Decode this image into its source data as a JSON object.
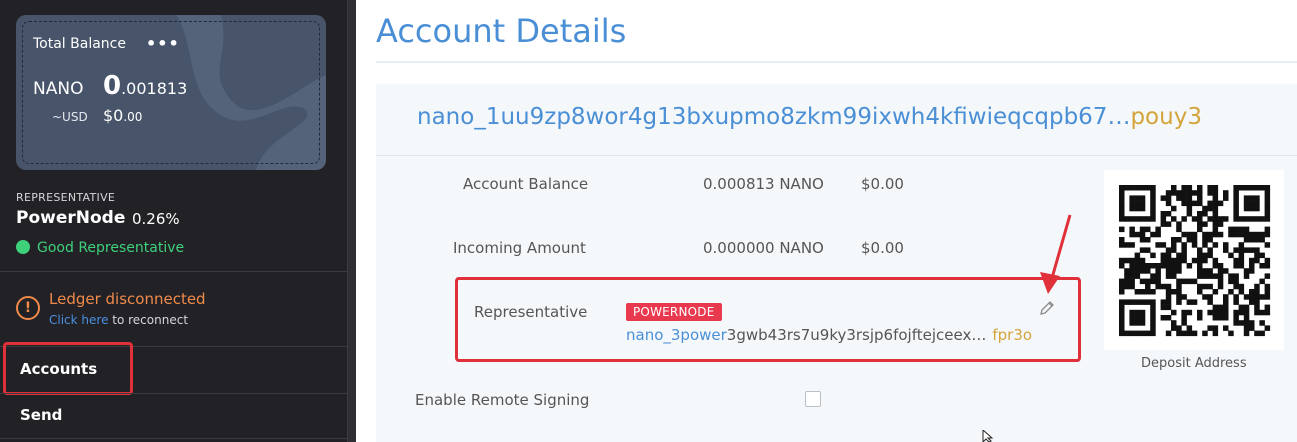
{
  "sidebar": {
    "balance_card": {
      "title": "Total Balance",
      "menu_icon": "more-dots-icon",
      "nano_label": "NANO",
      "nano_value_whole": "0",
      "nano_value_fraction": ".001813",
      "usd_label": "~USD",
      "usd_value_main": "$0",
      "usd_value_fraction": ".00"
    },
    "representative": {
      "heading": "REPRESENTATIVE",
      "name": "PowerNode",
      "percent": "0.26%",
      "status": "Good Representative",
      "status_color": "#3fd07c"
    },
    "ledger": {
      "title": "Ledger disconnected",
      "link_text": "Click here",
      "suffix_text": " to reconnect",
      "color": "#f08a4b"
    },
    "nav": [
      {
        "label": "Accounts",
        "active": true
      },
      {
        "label": "Send",
        "active": false
      }
    ]
  },
  "main": {
    "title": "Account Details",
    "address": {
      "head": "nano_1uu9zp8wor4g13bxupmo8zkm99ixwh4kfiwieqcqpb67…",
      "tail": "pouy3"
    },
    "rows": {
      "balance": {
        "label": "Account Balance",
        "nano": "0.000813 NANO",
        "usd": "$0.00"
      },
      "incoming": {
        "label": "Incoming Amount",
        "nano": "0.000000 NANO",
        "usd": "$0.00"
      },
      "representative": {
        "label": "Representative",
        "badge": "POWERNODE",
        "addr_head": "nano_3power",
        "addr_mid": "3gwb43rs7u9ky3rsjp6fojftejceex…",
        "addr_tail": "fpr3o",
        "edit_icon": "pencil-icon"
      },
      "remote_signing": {
        "label": "Enable Remote Signing",
        "checked": false
      }
    },
    "qr": {
      "label": "Deposit Address",
      "icon": "qr-code"
    }
  },
  "colors": {
    "accent_blue": "#4a8fd6",
    "address_gold": "#d3a43a",
    "highlight_red": "#e0303a",
    "sidebar_bg": "#222226"
  }
}
